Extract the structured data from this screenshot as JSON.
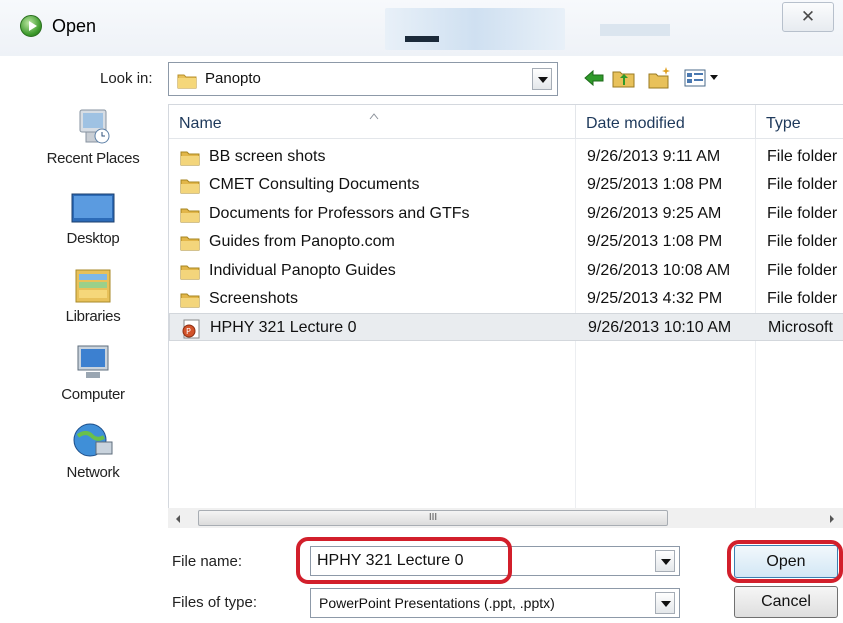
{
  "window": {
    "title": "Open",
    "close_glyph": "✕"
  },
  "lookin": {
    "label": "Look in:",
    "value": "Panopto"
  },
  "toolbar": {
    "icons": [
      "back-icon",
      "up-folder-icon",
      "new-folder-icon",
      "views-menu-icon"
    ]
  },
  "places": [
    {
      "label": "Recent Places",
      "icon": "recent-places-icon"
    },
    {
      "label": "Desktop",
      "icon": "desktop-icon"
    },
    {
      "label": "Libraries",
      "icon": "libraries-icon"
    },
    {
      "label": "Computer",
      "icon": "computer-icon"
    },
    {
      "label": "Network",
      "icon": "network-icon"
    }
  ],
  "columns": {
    "name": "Name",
    "date": "Date modified",
    "type": "Type"
  },
  "files": [
    {
      "name": "BB screen shots",
      "date": "9/26/2013 9:11 AM",
      "type": "File folder",
      "icon": "folder-icon"
    },
    {
      "name": "CMET Consulting Documents",
      "date": "9/25/2013 1:08 PM",
      "type": "File folder",
      "icon": "folder-icon"
    },
    {
      "name": "Documents for Professors and GTFs",
      "date": "9/26/2013 9:25 AM",
      "type": "File folder",
      "icon": "folder-icon"
    },
    {
      "name": "Guides from Panopto.com",
      "date": "9/25/2013 1:08 PM",
      "type": "File folder",
      "icon": "folder-icon"
    },
    {
      "name": "Individual Panopto Guides",
      "date": "9/26/2013 10:08 AM",
      "type": "File folder",
      "icon": "folder-icon"
    },
    {
      "name": "Screenshots",
      "date": "9/25/2013 4:32 PM",
      "type": "File folder",
      "icon": "folder-icon"
    },
    {
      "name": "HPHY 321 Lecture 0",
      "date": "9/26/2013 10:10 AM",
      "type": "Microsoft",
      "icon": "powerpoint-file-icon",
      "selected": true
    }
  ],
  "scrollbar": {
    "thumb_grip": "III"
  },
  "filename": {
    "label": "File name:",
    "value": "HPHY 321 Lecture 0"
  },
  "filetype": {
    "label": "Files of type:",
    "value": "PowerPoint Presentations (.ppt, .pptx)"
  },
  "buttons": {
    "open": "Open",
    "cancel": "Cancel"
  },
  "colors": {
    "annotation_red": "#d21f2b",
    "header_text": "#1e395b"
  }
}
